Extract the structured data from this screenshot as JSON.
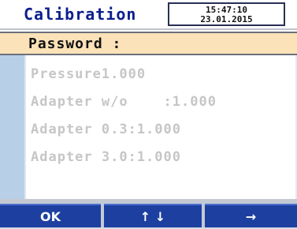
{
  "header": {
    "title": "Calibration",
    "time": "15:47:10",
    "date": "23.01.2015"
  },
  "password": {
    "label": "Password  :"
  },
  "menu": {
    "items": [
      {
        "label": "Pressure1.000"
      },
      {
        "label": "Adapter w/o    :1.000"
      },
      {
        "label": "Adapter 0.3:1.000"
      },
      {
        "label": "Adapter 3.0:1.000"
      }
    ]
  },
  "footer": {
    "ok_label": "OK",
    "updown_label": "↑ ↓",
    "right_label": "→"
  },
  "colors": {
    "title": "#0b1e8c",
    "password_row_bg": "#fbe2b8",
    "button_bg": "#1c3fa0",
    "left_bar": "#b8cfe8",
    "disabled_text": "#c6c6c6"
  }
}
